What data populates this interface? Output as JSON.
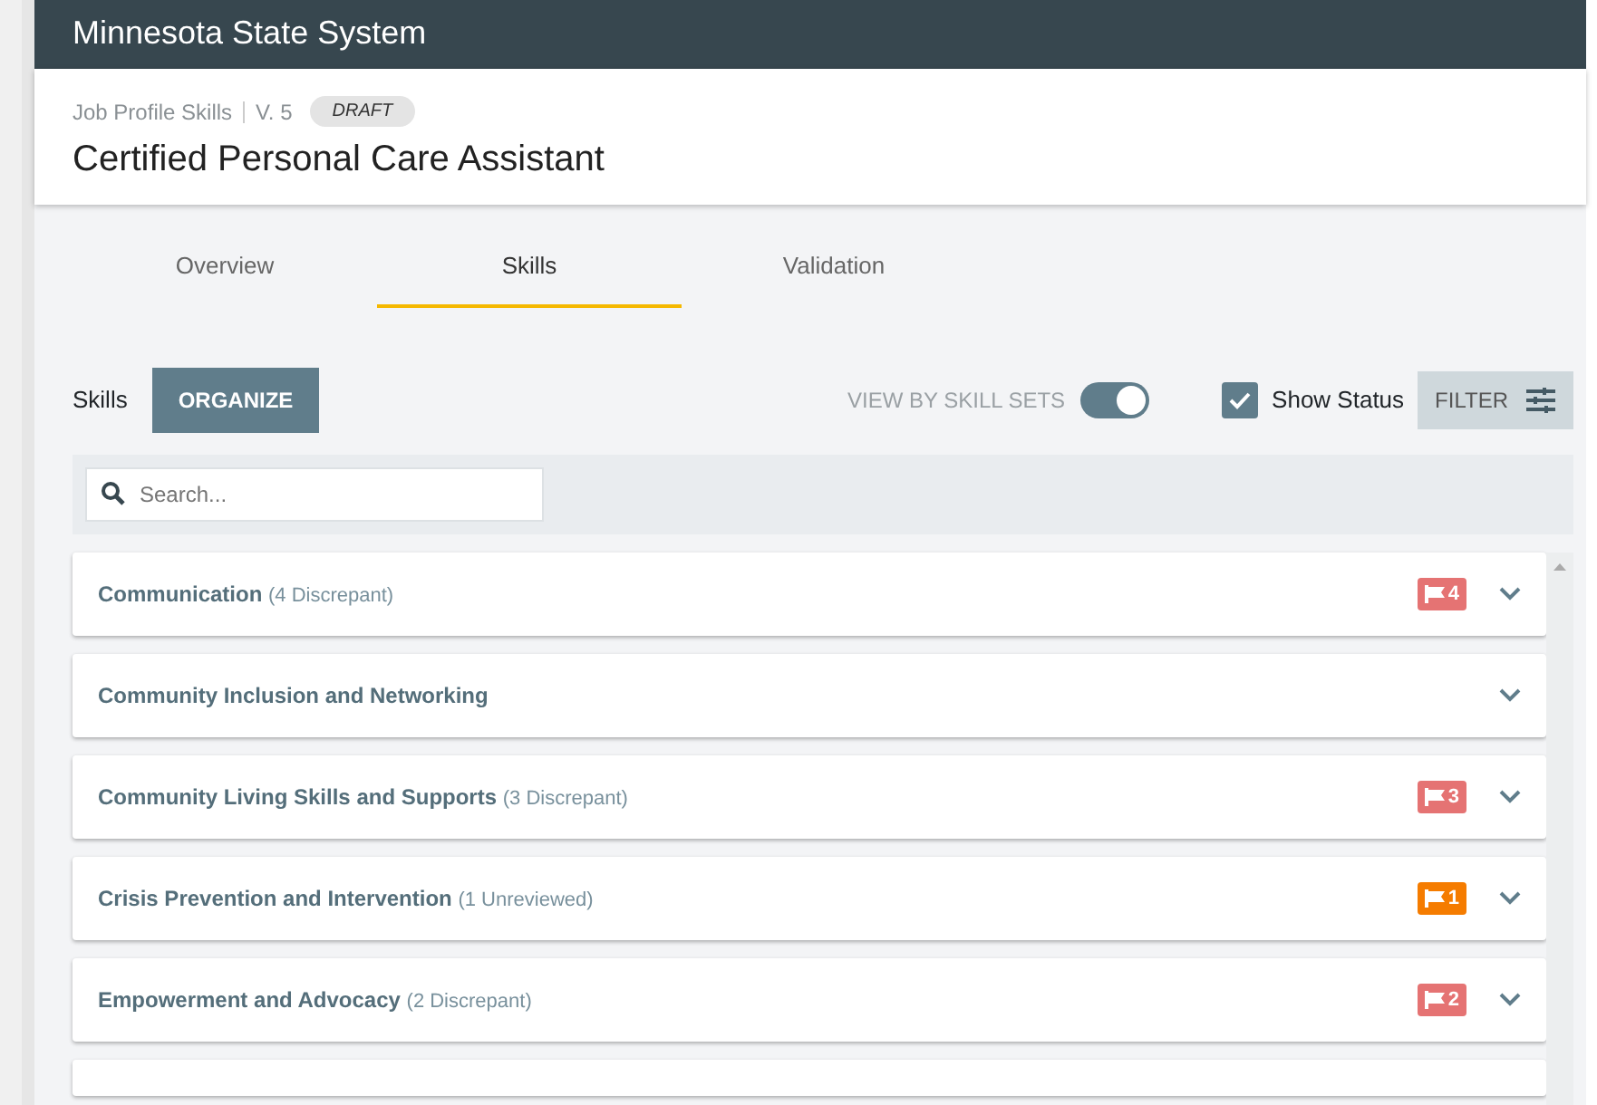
{
  "header": {
    "title": "Minnesota State System"
  },
  "profile": {
    "breadcrumb": "Job Profile Skills",
    "version": "V. 5",
    "status": "DRAFT",
    "title": "Certified Personal Care Assistant"
  },
  "tabs": [
    {
      "label": "Overview",
      "selected": false
    },
    {
      "label": "Skills",
      "selected": true
    },
    {
      "label": "Validation",
      "selected": false
    }
  ],
  "toolbar": {
    "label": "Skills",
    "organize": "ORGANIZE",
    "view_toggle": {
      "label": "VIEW BY SKILL SETS",
      "on": true
    },
    "show_status": {
      "label": "Show Status",
      "checked": true
    },
    "filter": "FILTER"
  },
  "search": {
    "placeholder": "Search..."
  },
  "skills": [
    {
      "name": "Communication",
      "note": "(4 Discrepant)",
      "flag": {
        "count": "4",
        "color": "#e57373"
      }
    },
    {
      "name": "Community Inclusion and Networking"
    },
    {
      "name": "Community Living Skills and Supports",
      "note": "(3 Discrepant)",
      "flag": {
        "count": "3",
        "color": "#e57373"
      }
    },
    {
      "name": "Crisis Prevention and Intervention",
      "note": "(1 Unreviewed)",
      "flag": {
        "count": "1",
        "color": "#f57c00"
      }
    },
    {
      "name": "Empowerment and Advocacy",
      "note": "(2 Discrepant)",
      "flag": {
        "count": "2",
        "color": "#e57373"
      }
    }
  ]
}
